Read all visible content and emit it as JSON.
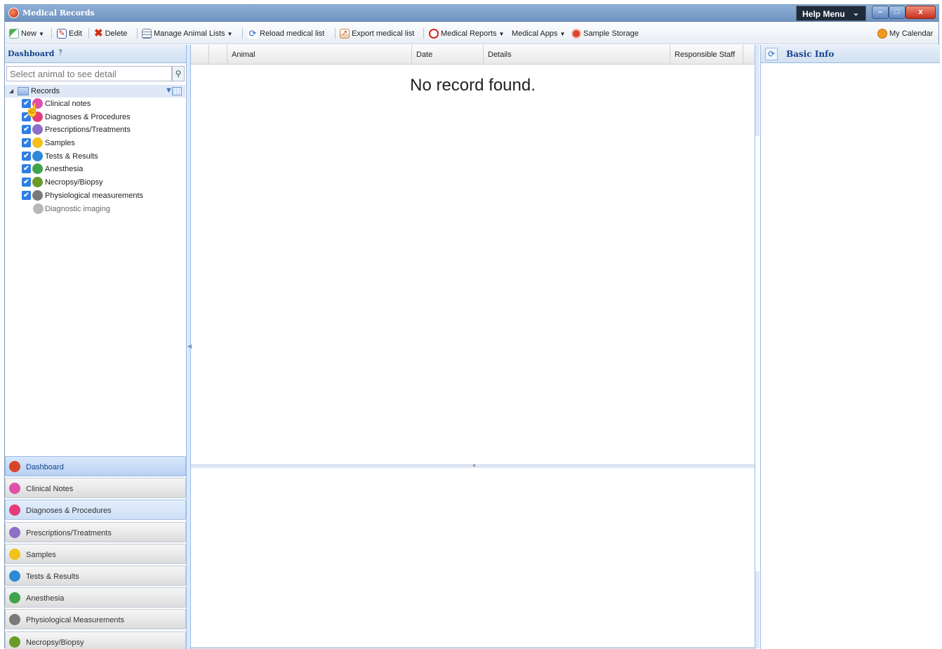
{
  "window": {
    "title": "Medical Records",
    "help_menu": "Help Menu",
    "min_label": "–",
    "max_label": "□",
    "close_label": "x"
  },
  "toolbar": {
    "new": "New",
    "edit": "Edit",
    "delete": "Delete",
    "manage_lists": "Manage Animal Lists",
    "reload": "Reload medical list",
    "export": "Export medical list",
    "reports": "Medical Reports",
    "apps": "Medical Apps",
    "sample_storage": "Sample Storage",
    "calendar": "My Calendar"
  },
  "dashboard": {
    "title": "Dashboard",
    "search_placeholder": "Select animal to see detail",
    "tree_root": "Records",
    "tree_items": [
      {
        "label": "Clinical notes",
        "checked": true,
        "icon": "clinical-notes-icon",
        "color": "#e04fa8"
      },
      {
        "label": "Diagnoses & Procedures",
        "checked": true,
        "icon": "diagnoses-icon",
        "color": "#e63b7a"
      },
      {
        "label": "Prescriptions/Treatments",
        "checked": true,
        "icon": "prescription-icon",
        "color": "#8c6fc7"
      },
      {
        "label": "Samples",
        "checked": true,
        "icon": "samples-icon",
        "color": "#f2c21b"
      },
      {
        "label": "Tests & Results",
        "checked": true,
        "icon": "tests-icon",
        "color": "#2c8ad6"
      },
      {
        "label": "Anesthesia",
        "checked": true,
        "icon": "anesthesia-icon",
        "color": "#3fa34a"
      },
      {
        "label": "Necropsy/Biopsy",
        "checked": true,
        "icon": "necropsy-icon",
        "color": "#6a9a2a"
      },
      {
        "label": "Physiological measurements",
        "checked": true,
        "icon": "physiological-icon",
        "color": "#7a7a7a"
      },
      {
        "label": "Diagnostic imaging",
        "checked": false,
        "icon": "imaging-icon",
        "color": "#b8b8b8"
      }
    ]
  },
  "accordion": [
    {
      "label": "Dashboard",
      "icon": "dashboard-icon",
      "color": "#d9452b",
      "state": "active"
    },
    {
      "label": "Clinical Notes",
      "icon": "clinical-notes-icon",
      "color": "#e04fa8",
      "state": "normal"
    },
    {
      "label": "Diagnoses & Procedures",
      "icon": "diagnoses-icon",
      "color": "#e63b7a",
      "state": "hover"
    },
    {
      "label": "Prescriptions/Treatments",
      "icon": "prescription-icon",
      "color": "#8c6fc7",
      "state": "normal"
    },
    {
      "label": "Samples",
      "icon": "samples-icon",
      "color": "#f2c21b",
      "state": "normal"
    },
    {
      "label": "Tests & Results",
      "icon": "tests-icon",
      "color": "#2c8ad6",
      "state": "normal"
    },
    {
      "label": "Anesthesia",
      "icon": "anesthesia-icon",
      "color": "#3fa34a",
      "state": "normal"
    },
    {
      "label": "Physiological Measurements",
      "icon": "physiological-icon",
      "color": "#7a7a7a",
      "state": "normal"
    },
    {
      "label": "Necropsy/Biopsy",
      "icon": "necropsy-icon",
      "color": "#6a9a2a",
      "state": "normal"
    }
  ],
  "grid": {
    "columns": [
      "Animal",
      "Date",
      "Details",
      "Responsible Staff"
    ],
    "empty_message": "No record found."
  },
  "basic_info": {
    "title": "Basic Info"
  }
}
